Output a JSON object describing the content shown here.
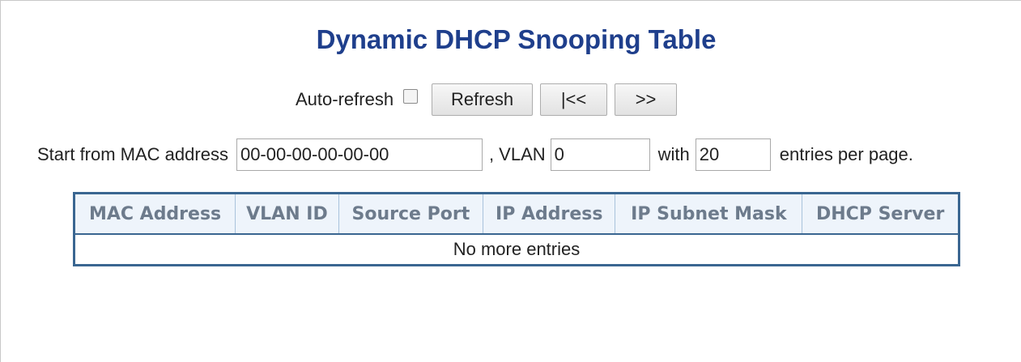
{
  "page": {
    "title": "Dynamic DHCP Snooping Table"
  },
  "controls": {
    "auto_refresh_label": "Auto-refresh",
    "auto_refresh_checked": false,
    "refresh_label": "Refresh",
    "first_page_label": "|<<",
    "next_page_label": ">>"
  },
  "filter": {
    "start_label": "Start from MAC address",
    "mac_value": "00-00-00-00-00-00",
    "vlan_label": ", VLAN",
    "vlan_value": "0",
    "with_label": "with",
    "entries_value": "20",
    "entries_suffix": "entries per page."
  },
  "table": {
    "columns": [
      "MAC Address",
      "VLAN ID",
      "Source Port",
      "IP Address",
      "IP Subnet Mask",
      "DHCP Server"
    ],
    "empty_message": "No more entries"
  },
  "colors": {
    "title": "#1f3f8c",
    "table_border": "#3a6691",
    "header_bg": "#eef4fb",
    "header_text": "#6d7b8c"
  }
}
